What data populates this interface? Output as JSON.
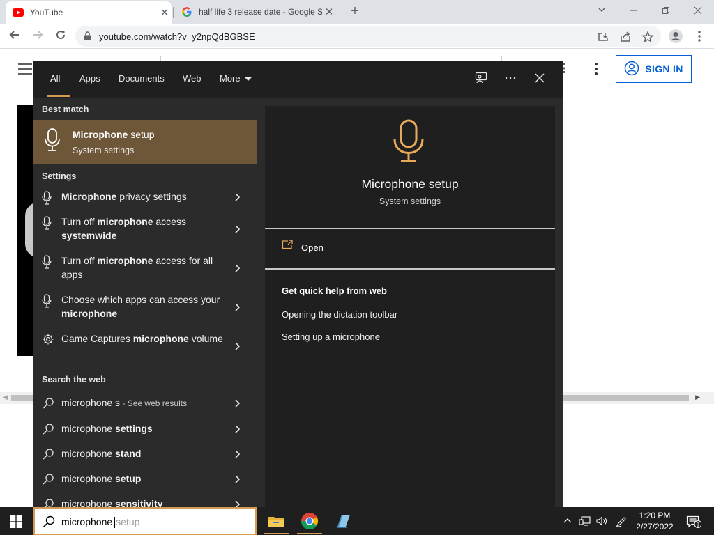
{
  "browser": {
    "tabs": [
      {
        "title": "YouTube",
        "icon": "youtube-icon",
        "active": true
      },
      {
        "title": "half life 3 release date - Google S",
        "icon": "google-icon",
        "active": false
      }
    ],
    "url": "youtube.com/watch?v=y2npQdBGBSE"
  },
  "youtube": {
    "sign_in_label": "SIGN IN",
    "accent_color": "#065fd4"
  },
  "search_panel": {
    "tabs": [
      "All",
      "Apps",
      "Documents",
      "Web",
      "More"
    ],
    "active_tab": "All",
    "accent_color": "#d69b53",
    "best_match_header": "Best match",
    "best_match": {
      "title_bold": "Microphone",
      "title_rest": " setup",
      "subtitle": "System settings",
      "icon": "microphone-icon"
    },
    "settings_header": "Settings",
    "settings_items": [
      {
        "icon": "microphone-icon",
        "parts": [
          {
            "t": "Microphone",
            "b": true
          },
          {
            "t": " privacy settings",
            "b": false
          }
        ]
      },
      {
        "icon": "microphone-icon",
        "parts": [
          {
            "t": "Turn off ",
            "b": false
          },
          {
            "t": "microphone",
            "b": true
          },
          {
            "t": " access ",
            "b": false
          },
          {
            "t": "systemwide",
            "b": true
          }
        ]
      },
      {
        "icon": "microphone-icon",
        "parts": [
          {
            "t": "Turn off ",
            "b": false
          },
          {
            "t": "microphone",
            "b": true
          },
          {
            "t": " access for all apps",
            "b": false
          }
        ]
      },
      {
        "icon": "microphone-icon",
        "parts": [
          {
            "t": "Choose which apps can access your ",
            "b": false
          },
          {
            "t": "microphone",
            "b": true
          }
        ]
      },
      {
        "icon": "gear-icon",
        "parts": [
          {
            "t": "Game Captures ",
            "b": false
          },
          {
            "t": "microphone",
            "b": true
          },
          {
            "t": " volume",
            "b": false
          }
        ]
      }
    ],
    "web_header": "Search the web",
    "web_items": [
      {
        "parts": [
          {
            "t": "microphone s",
            "b": false
          }
        ],
        "sub": " - See web results"
      },
      {
        "parts": [
          {
            "t": "microphone ",
            "b": false
          },
          {
            "t": "settings",
            "b": true
          }
        ],
        "sub": ""
      },
      {
        "parts": [
          {
            "t": "microphone ",
            "b": false
          },
          {
            "t": "stand",
            "b": true
          }
        ],
        "sub": ""
      },
      {
        "parts": [
          {
            "t": "microphone ",
            "b": false
          },
          {
            "t": "setup",
            "b": true
          }
        ],
        "sub": ""
      },
      {
        "parts": [
          {
            "t": "microphone ",
            "b": false
          },
          {
            "t": "sensitivity",
            "b": true
          }
        ],
        "sub": ""
      }
    ],
    "preview": {
      "title": "Microphone setup",
      "subtitle": "System settings",
      "open_label": "Open",
      "help_header": "Get quick help from web",
      "help_links": [
        "Opening the dictation toolbar",
        "Setting up a microphone"
      ]
    }
  },
  "taskbar": {
    "search_typed": "microphone",
    "search_suggestion": "setup",
    "time": "1:20 PM",
    "date": "2/27/2022",
    "notification_count": "1"
  }
}
